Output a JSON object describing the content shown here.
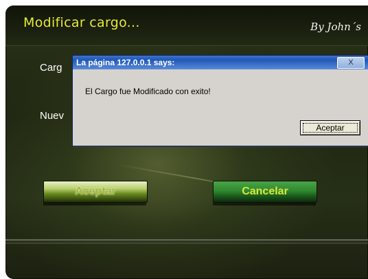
{
  "app": {
    "title": "Modificar cargo...",
    "author": "By John´s",
    "labels": {
      "cargo": "Carg",
      "nuevo": "Nuev"
    },
    "buttons": {
      "accept": "Aceptar",
      "cancel": "Cancelar"
    }
  },
  "dialog": {
    "title": "La página 127.0.0.1 says:",
    "close_label": "X",
    "message": "El Cargo fue Modificado con exito!",
    "ok_label": "Aceptar"
  },
  "colors": {
    "panel_bg": "#1f2612",
    "title_accent": "#e4ea37",
    "dialog_titlebar": "#1f58b8",
    "dialog_body": "#d6d3ce"
  }
}
